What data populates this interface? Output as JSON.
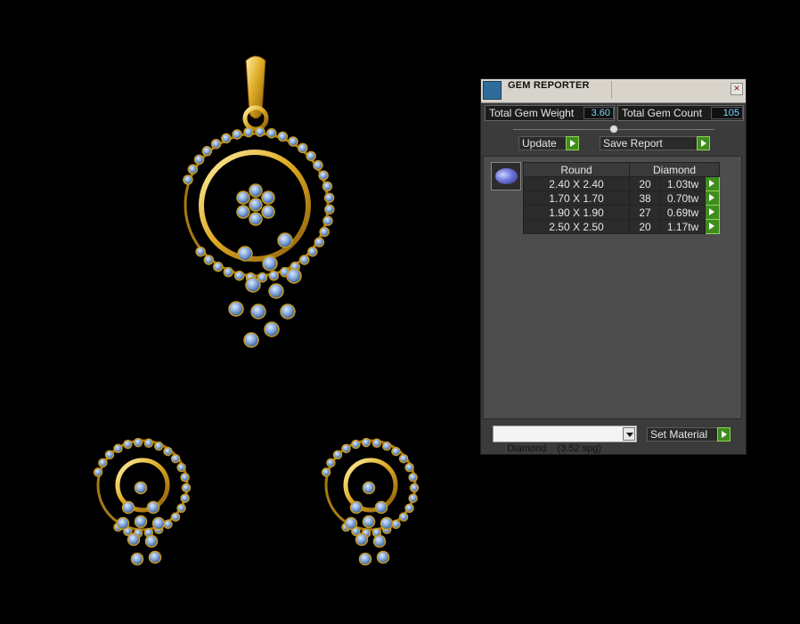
{
  "viewport": {
    "description_icon": "jewelry-render"
  },
  "panel": {
    "title": "GEM REPORTER",
    "close_icon": "close-icon",
    "total_gem_weight_label": "Total Gem Weight",
    "total_gem_weight_value": "3.60",
    "total_gem_count_label": "Total Gem Count",
    "total_gem_count_value": "105",
    "update_label": "Update",
    "save_report_label": "Save Report",
    "table": {
      "headers": [
        "Round",
        "Diamond"
      ],
      "rows": [
        {
          "size": "2.40 X 2.40",
          "count": "20",
          "weight": "1.03tw"
        },
        {
          "size": "1.70 X 1.70",
          "count": "38",
          "weight": "0.70tw"
        },
        {
          "size": "1.90 X 1.90",
          "count": "27",
          "weight": "0.69tw"
        },
        {
          "size": "2.50 X 2.50",
          "count": "20",
          "weight": "1.17tw"
        }
      ]
    },
    "material_value": "Diamond    (3.52 spg)",
    "set_material_label": "Set Material"
  },
  "colors": {
    "gold": "#d9a521",
    "gem": "#7fa4d8",
    "accent": "#3f8d1f"
  }
}
